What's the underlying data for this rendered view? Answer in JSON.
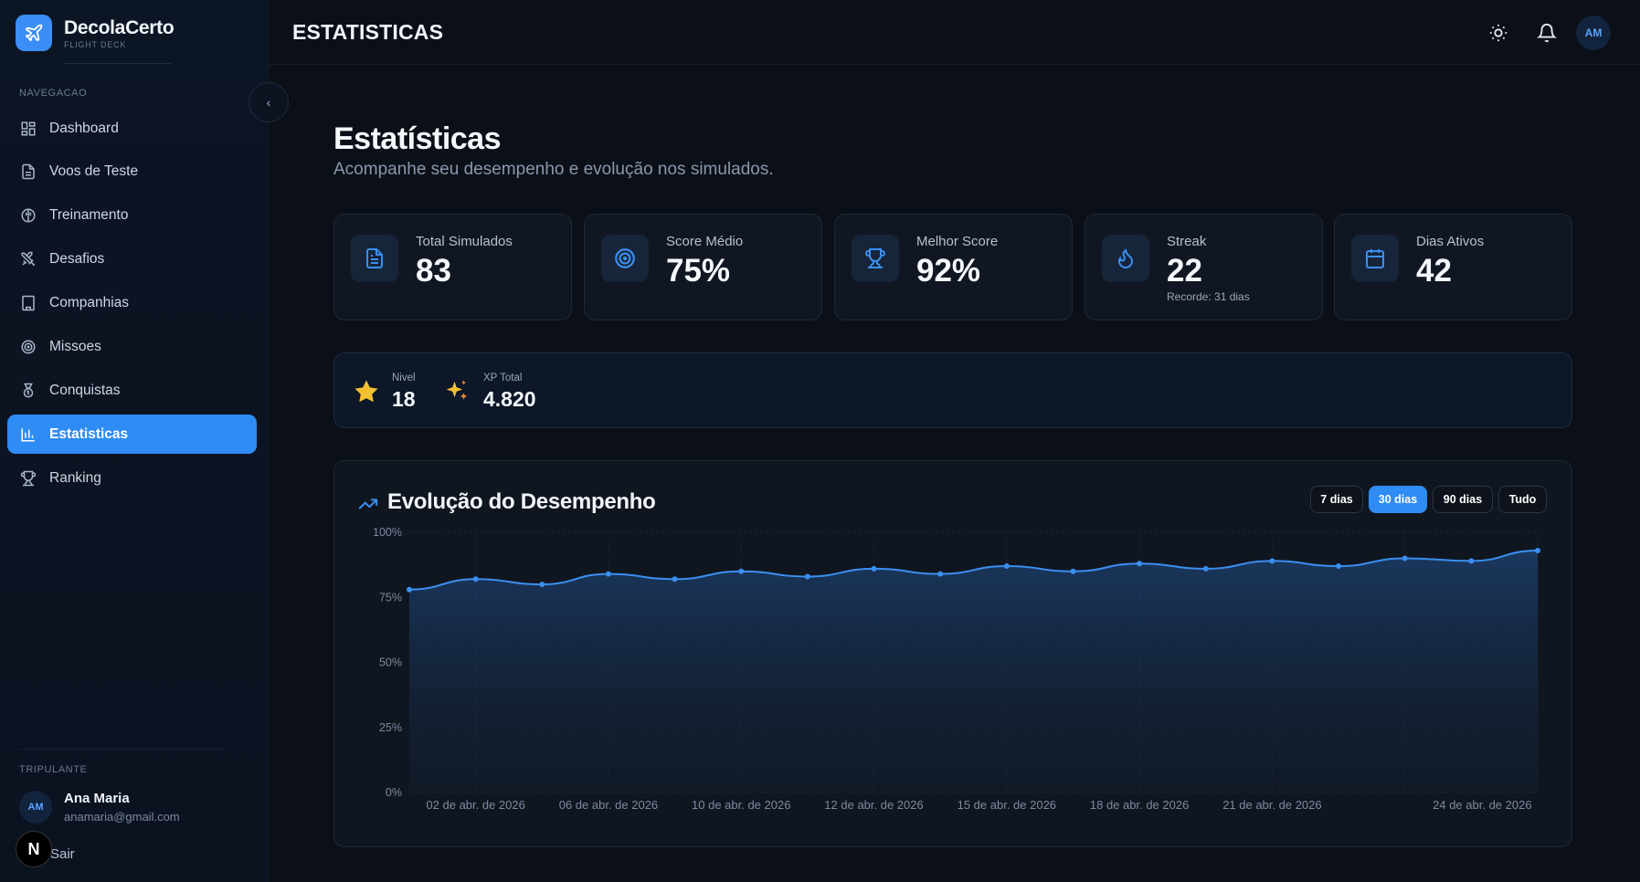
{
  "brand": {
    "name": "DecolaCerto",
    "subtitle": "FLIGHT DECK"
  },
  "sidebar": {
    "nav_header": "NAVEGACAO",
    "items": [
      {
        "label": "Dashboard",
        "icon": "grid-icon"
      },
      {
        "label": "Voos de Teste",
        "icon": "document-icon"
      },
      {
        "label": "Treinamento",
        "icon": "brain-icon"
      },
      {
        "label": "Desafios",
        "icon": "swords-icon"
      },
      {
        "label": "Companhias",
        "icon": "building-icon"
      },
      {
        "label": "Missoes",
        "icon": "target-icon"
      },
      {
        "label": "Conquistas",
        "icon": "medal-icon"
      },
      {
        "label": "Estatisticas",
        "icon": "bar-chart-icon",
        "active": true
      },
      {
        "label": "Ranking",
        "icon": "trophy-icon"
      }
    ],
    "crew_header": "TRIPULANTE",
    "user": {
      "initials": "AM",
      "name": "Ana Maria",
      "email": "anamaria@gmail.com"
    },
    "logout_label": "Sair",
    "n_badge": "N"
  },
  "topbar": {
    "title": "ESTATISTICAS",
    "avatar_initials": "AM"
  },
  "page": {
    "title": "Estatísticas",
    "subtitle": "Acompanhe seu desempenho e evolução nos simulados."
  },
  "stats": [
    {
      "label": "Total Simulados",
      "value": "83",
      "icon": "document-icon"
    },
    {
      "label": "Score Médio",
      "value": "75%",
      "icon": "target-icon"
    },
    {
      "label": "Melhor Score",
      "value": "92%",
      "icon": "trophy-icon"
    },
    {
      "label": "Streak",
      "value": "22",
      "extra": "Recorde: 31 dias",
      "icon": "flame-icon"
    },
    {
      "label": "Dias Ativos",
      "value": "42",
      "icon": "calendar-icon"
    }
  ],
  "level": {
    "level_label": "Nivel",
    "level_value": "18",
    "xp_label": "XP Total",
    "xp_value": "4.820"
  },
  "chart": {
    "title": "Evolução do Desempenho",
    "ranges": [
      "7 dias",
      "30 dias",
      "90 dias",
      "Tudo"
    ],
    "active_range": "30 dias"
  },
  "chart_data": {
    "type": "area",
    "title": "Evolução do Desempenho",
    "ylim": [
      0,
      100
    ],
    "yticks": [
      "0%",
      "25%",
      "50%",
      "75%",
      "100%"
    ],
    "xtick_labels": [
      "02 de abr. de 2026",
      "06 de abr. de 2026",
      "10 de abr. de 2026",
      "12 de abr. de 2026",
      "15 de abr. de 2026",
      "18 de abr. de 2026",
      "21 de abr. de 2026",
      "24 de abr. de 2026"
    ],
    "values": [
      78,
      82,
      80,
      84,
      82,
      85,
      83,
      86,
      84,
      87,
      85,
      88,
      86,
      89,
      87,
      90,
      89,
      93
    ],
    "grid": true,
    "color": "#3b8ff0"
  }
}
